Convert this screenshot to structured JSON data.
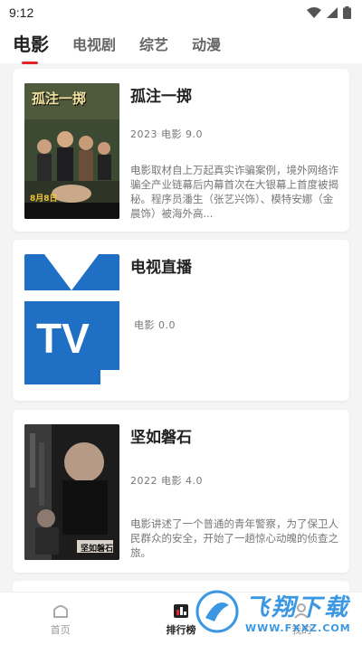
{
  "status": {
    "time": "9:12"
  },
  "tabs": [
    {
      "label": "电影",
      "active": true
    },
    {
      "label": "电视剧",
      "active": false
    },
    {
      "label": "综艺",
      "active": false
    },
    {
      "label": "动漫",
      "active": false
    }
  ],
  "cards": [
    {
      "title": "孤注一掷",
      "meta": "2023 电影 9.0",
      "description": "电影取材自上万起真实诈骗案例，境外网络诈骗全产业链幕后内幕首次在大银幕上首度被揭秘。程序员潘生（张艺兴饰）、模特安娜（金晨饰）被海外高...",
      "poster_text": "孤注一掷",
      "poster_date": "8月8日"
    },
    {
      "title": "电视直播",
      "meta": "电影 0.0",
      "description": "",
      "poster_text": "TV"
    },
    {
      "title": "坚如磐石",
      "meta": "2022 电影 4.0",
      "description": "电影讲述了一个普通的青年警察，为了保卫人民群众的安全，开始了一趟惊心动魄的侦查之旅。",
      "poster_text": "坚如磐石"
    }
  ],
  "bottom_nav": [
    {
      "label": "首页",
      "icon": "home-icon",
      "active": false
    },
    {
      "label": "排行榜",
      "icon": "ranking-icon",
      "active": true
    },
    {
      "label": "我的",
      "icon": "profile-icon",
      "active": false
    }
  ],
  "watermark": {
    "title": "飞翔下载",
    "url": "WWW.FXXZ.COM"
  },
  "colors": {
    "accent": "#e0262c",
    "tv_blue": "#1f6fc5",
    "watermark": "#2b8fe0"
  }
}
